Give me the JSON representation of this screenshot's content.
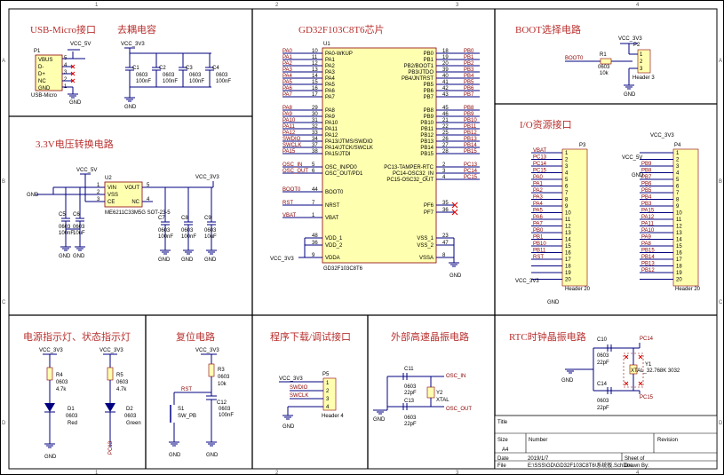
{
  "frame": {
    "cols": [
      "1",
      "2",
      "3",
      "4"
    ],
    "rows": [
      "A",
      "B",
      "C",
      "D"
    ]
  },
  "sections": {
    "usb": "USB-Micro接口",
    "decap": "去耦电容",
    "chip": "GD32F103C8T6芯片",
    "boot": "BOOT选择电路",
    "ldo": "3.3V电压转换电路",
    "io": "I/O资源接口",
    "led": "电源指示灯、状态指示灯",
    "reset": "复位电路",
    "debug": "程序下载/调试接口",
    "hse": "外部高速晶振电路",
    "rtc": "RTC时钟晶振电路"
  },
  "usb": {
    "ref": "P1",
    "part": "USB-Micro",
    "vcc": "VCC_5V",
    "gnd": "GND",
    "pins": [
      "VBUS",
      "D-",
      "D+",
      "NC",
      "GND"
    ],
    "nums": [
      "5",
      "4",
      "3",
      "2",
      "1"
    ]
  },
  "decap": {
    "vcc": "VCC_3V3",
    "gnd": "GND",
    "caps": [
      {
        "ref": "C1",
        "pkg": "0603",
        "val": "100nF"
      },
      {
        "ref": "C2",
        "pkg": "0603",
        "val": "100nF"
      },
      {
        "ref": "C3",
        "pkg": "0603",
        "val": "100nF"
      },
      {
        "ref": "C4",
        "pkg": "0603",
        "val": "100nF"
      }
    ]
  },
  "mcu": {
    "ref": "U1",
    "part": "GD32F103C8T6",
    "left": [
      {
        "num": "10",
        "name": "PA0-WKUP",
        "net": "PA0"
      },
      {
        "num": "11",
        "name": "PA1",
        "net": "PA1"
      },
      {
        "num": "12",
        "name": "PA2",
        "net": "PA2"
      },
      {
        "num": "13",
        "name": "PA3",
        "net": "PA3"
      },
      {
        "num": "14",
        "name": "PA4",
        "net": "PA4"
      },
      {
        "num": "15",
        "name": "PA5",
        "net": "PA5"
      },
      {
        "num": "16",
        "name": "PA6",
        "net": "PA6"
      },
      {
        "num": "17",
        "name": "PA7",
        "net": "PA7"
      },
      {
        "num": "29",
        "name": "PA8",
        "net": "PA8"
      },
      {
        "num": "30",
        "name": "PA9",
        "net": "PA9"
      },
      {
        "num": "31",
        "name": "PA10",
        "net": "PA10"
      },
      {
        "num": "32",
        "name": "PA11",
        "net": "PA11"
      },
      {
        "num": "33",
        "name": "PA12",
        "net": "PA12"
      },
      {
        "num": "34",
        "name": "PA13/JTMS/SWDIO",
        "net": "SWDIO"
      },
      {
        "num": "37",
        "name": "PA14/JTCK/SWCLK",
        "net": "SWCLK"
      },
      {
        "num": "38",
        "name": "PA15/JTDI",
        "net": "PA15"
      }
    ],
    "right": [
      {
        "num": "18",
        "name": "PB0",
        "net": "PB0"
      },
      {
        "num": "19",
        "name": "PB1",
        "net": "PB1"
      },
      {
        "num": "20",
        "name": "PB2/BOOT1",
        "net": "PB2"
      },
      {
        "num": "39",
        "name": "PB3/JTDO",
        "net": "PB3"
      },
      {
        "num": "40",
        "name": "PB4/JNTRST",
        "net": "PB4"
      },
      {
        "num": "41",
        "name": "PB5",
        "net": "PB5"
      },
      {
        "num": "42",
        "name": "PB6",
        "net": "PB6"
      },
      {
        "num": "43",
        "name": "PB7",
        "net": "PB7"
      },
      {
        "num": "45",
        "name": "PB8",
        "net": "PB8"
      },
      {
        "num": "46",
        "name": "PB9",
        "net": "PB9"
      },
      {
        "num": "21",
        "name": "PB10",
        "net": "PB10"
      },
      {
        "num": "22",
        "name": "PB11",
        "net": "PB11"
      },
      {
        "num": "25",
        "name": "PB12",
        "net": "PB12"
      },
      {
        "num": "26",
        "name": "PB13",
        "net": "PB13"
      },
      {
        "num": "27",
        "name": "PB14",
        "net": "PB14"
      },
      {
        "num": "28",
        "name": "PB15",
        "net": "PB15"
      }
    ],
    "osc": [
      {
        "num": "5",
        "name": "OSC_IN/PD0",
        "net": "OSC_IN"
      },
      {
        "num": "6",
        "name": "OSC_OUT/PD1",
        "net": "OSC_OUT"
      }
    ],
    "pc": [
      {
        "num": "2",
        "name": "PC13-TAMPER-RTC",
        "net": "PC13"
      },
      {
        "num": "3",
        "name": "PC14-OSC32_IN",
        "net": "PC14"
      },
      {
        "num": "4",
        "name": "PC15-OSC32_OUT",
        "net": "PC15"
      }
    ],
    "boot": {
      "num": "44",
      "name": "BOOT0",
      "net": "BOOT0"
    },
    "nrst": {
      "num": "7",
      "name": "NRST",
      "net": "RST"
    },
    "vbat": {
      "num": "1",
      "name": "VBAT",
      "net": "VBAT"
    },
    "pf": [
      {
        "num": "35",
        "name": "PF6"
      },
      {
        "num": "36",
        "name": "PF7"
      }
    ],
    "vdd": [
      {
        "num": "48",
        "name": "VDD_1"
      },
      {
        "num": "36",
        "name": "VDD_2"
      },
      {
        "num": "9",
        "name": "VDDA"
      }
    ],
    "vss": [
      {
        "num": "23",
        "name": "VSS_1"
      },
      {
        "num": "47",
        "name": "VSS_2"
      },
      {
        "num": "8",
        "name": "VSSA"
      }
    ],
    "vcc": "VCC_3V3",
    "gnd": "GND"
  },
  "boot": {
    "net": "BOOT0",
    "r": "R1",
    "rpkg": "0603",
    "rval": "10k",
    "vcc": "VCC_3V3",
    "gnd": "GND",
    "hdr": "P2",
    "hdrname": "Header 3",
    "pins": [
      "1",
      "2",
      "3"
    ]
  },
  "ldo": {
    "ref": "U2",
    "part": "ME6211C33M5G SOT-23-5",
    "pins_l": [
      {
        "num": "1",
        "name": "VIN"
      },
      {
        "num": "2",
        "name": "VSS"
      },
      {
        "num": "3",
        "name": "CE"
      }
    ],
    "pins_r": [
      {
        "num": "5",
        "name": "VOUT"
      },
      {
        "num": "4",
        "name": "NC"
      }
    ],
    "vin": "VCC_5V",
    "vout": "VCC_3V3",
    "gnd": "GND",
    "caps": [
      {
        "ref": "C5",
        "pkg": "0603",
        "val": "100nF"
      },
      {
        "ref": "C6",
        "pkg": "0603",
        "val": "10uF"
      },
      {
        "ref": "C7",
        "pkg": "0603",
        "val": "100nF"
      },
      {
        "ref": "C8",
        "pkg": "0603",
        "val": "100nF"
      },
      {
        "ref": "C9",
        "pkg": "0603",
        "val": "10uF"
      }
    ]
  },
  "io": {
    "p3": {
      "ref": "P3",
      "name": "Header 20",
      "vcc": "VCC_3V3",
      "gnd": "GND",
      "nets": [
        "VBAT",
        "PC13",
        "PC14",
        "PC15",
        "PA0",
        "PA1",
        "PA2",
        "PA3",
        "PA4",
        "PA5",
        "PA6",
        "PA7",
        "PB0",
        "PB1",
        "PB10",
        "PB11",
        "RST",
        "",
        "",
        ""
      ],
      "pins": [
        "1",
        "2",
        "3",
        "4",
        "5",
        "6",
        "7",
        "8",
        "9",
        "10",
        "11",
        "12",
        "13",
        "14",
        "15",
        "16",
        "17",
        "18",
        "19",
        "20"
      ]
    },
    "p4": {
      "ref": "P4",
      "name": "Header 20",
      "vcc": "VCC_5V",
      "vcc2": "VCC_3V3",
      "gnd": "GND",
      "nets": [
        "",
        "",
        "PB9",
        "PB8",
        "PB7",
        "PB6",
        "PB5",
        "PB4",
        "PB3",
        "PA15",
        "PA12",
        "PA11",
        "PA10",
        "PA9",
        "PA8",
        "PB15",
        "PB14",
        "PB13",
        "PB12",
        ""
      ],
      "pins": [
        "1",
        "2",
        "3",
        "4",
        "5",
        "6",
        "7",
        "8",
        "9",
        "10",
        "11",
        "12",
        "13",
        "14",
        "15",
        "16",
        "17",
        "18",
        "19",
        "20"
      ]
    }
  },
  "led": {
    "vcc": "VCC_3V3",
    "gnd": "GND",
    "r4": {
      "ref": "R4",
      "pkg": "0603",
      "val": "4.7k"
    },
    "r5": {
      "ref": "R5",
      "pkg": "0603",
      "val": "4.7k"
    },
    "d1": {
      "ref": "D1",
      "pkg": "0603",
      "val": "Red"
    },
    "d2": {
      "ref": "D2",
      "pkg": "0603",
      "val": "Green"
    },
    "pc13": "PC13"
  },
  "reset": {
    "vcc": "VCC_3V3",
    "gnd": "GND",
    "net": "RST",
    "r3": {
      "ref": "R3",
      "pkg": "0603",
      "val": "10k"
    },
    "s1": {
      "ref": "S1",
      "val": "SW_PB"
    },
    "c12": {
      "ref": "C12",
      "pkg": "0603",
      "val": "100nF"
    }
  },
  "debug": {
    "ref": "P5",
    "name": "Header 4",
    "vcc": "VCC_3V3",
    "gnd": "GND",
    "nets": [
      "SWDIO",
      "SWCLK"
    ],
    "pins": [
      "1",
      "2",
      "3",
      "4"
    ]
  },
  "hse": {
    "c11": {
      "ref": "C11",
      "pkg": "0603",
      "val": "22pF"
    },
    "c13": {
      "ref": "C13",
      "pkg": "0603",
      "val": "22pF"
    },
    "y2": {
      "ref": "Y2",
      "val": "XTAL"
    },
    "in": "OSC_IN",
    "out": "OSC_OUT",
    "gnd": "GND"
  },
  "rtc": {
    "c10": {
      "ref": "C10",
      "pkg": "0603",
      "val": "22pF"
    },
    "c14": {
      "ref": "C14",
      "pkg": "0603",
      "val": "22pF"
    },
    "y1": {
      "ref": "Y1",
      "val": "XTAL_32.768K 3032"
    },
    "pc14": "PC14",
    "pc15": "PC15",
    "gnd": "GND"
  },
  "titleblock": {
    "title": "Title",
    "size_h": "Size",
    "size": "A4",
    "number_h": "Number",
    "rev_h": "Revision",
    "date_h": "Date",
    "date": "2019/1/7",
    "sheet_h": "Sheet of",
    "file_h": "File",
    "file": "E:\\SSS\\GD\\GD32F103C8T6\\系统板.SchDoc",
    "drawn": "Drawn By:"
  }
}
